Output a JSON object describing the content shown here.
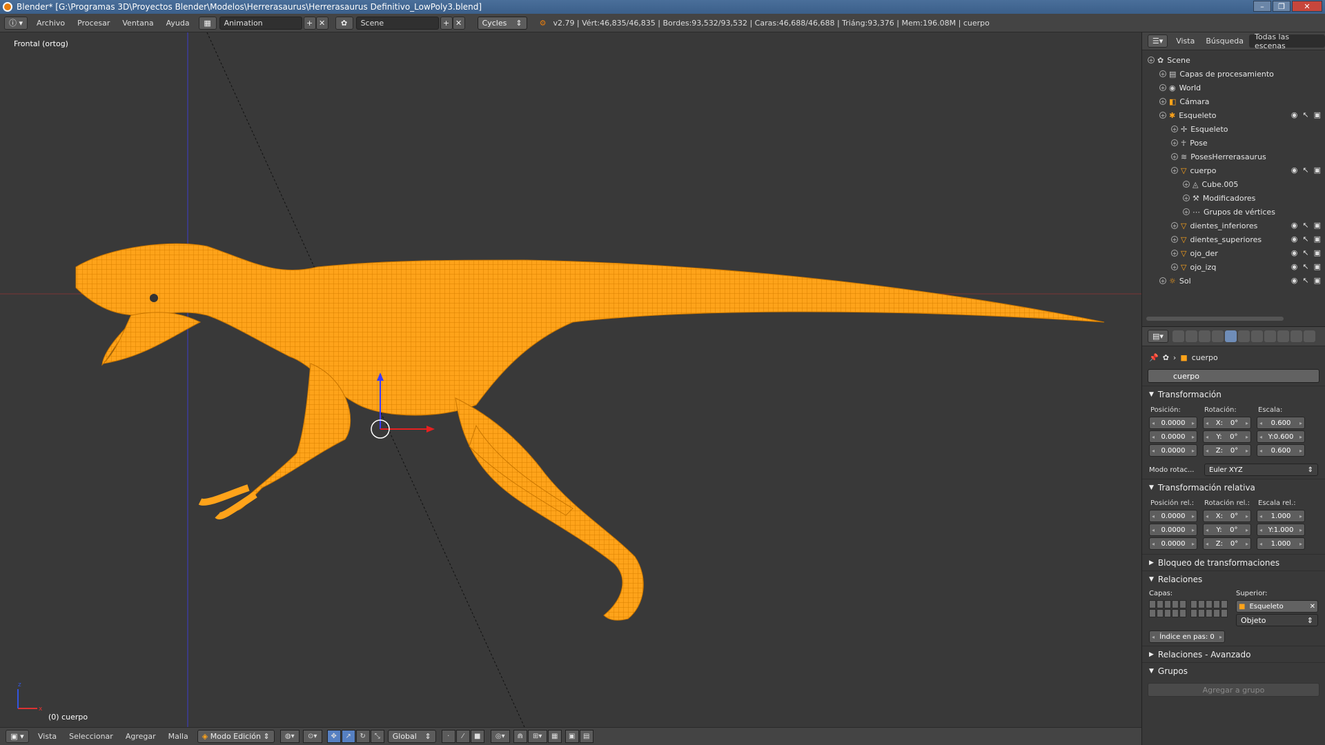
{
  "window": {
    "title": "Blender* [G:\\Programas 3D\\Proyectos Blender\\Modelos\\Herrerasaurus\\Herrerasaurus Definitivo_LowPoly3.blend]",
    "buttons": [
      "–",
      "❐",
      "✕"
    ]
  },
  "info_header": {
    "menus": [
      "Archivo",
      "Procesar",
      "Ventana",
      "Ayuda"
    ],
    "screen_layout": "Animation",
    "scene": "Scene",
    "render_engine": "Cycles",
    "stats": "v2.79 | Vért:46,835/46,835 | Bordes:93,532/93,532 | Caras:46,688/46,688 | Triáng:93,376 | Mem:196.08M | cuerpo"
  },
  "viewport": {
    "view_label": "Frontal (ortog)",
    "object_label": "(0) cuerpo",
    "mesh_color": "#ffa31a",
    "wire_color": "#e08600"
  },
  "bottom_header": {
    "menus": [
      "Vista",
      "Seleccionar",
      "Agregar",
      "Malla"
    ],
    "mode": "Modo Edición",
    "orientation": "Global"
  },
  "outliner": {
    "tabs": [
      "Vista",
      "Búsqueda",
      "Todas las escenas"
    ],
    "active_tab": "Todas las escenas",
    "items": [
      {
        "label": "Scene",
        "indent": 0,
        "icon": "scene-icon",
        "extra": ""
      },
      {
        "label": "Capas de procesamiento",
        "indent": 1,
        "icon": "render-layers-icon",
        "extra": ""
      },
      {
        "label": "World",
        "indent": 1,
        "icon": "world-icon",
        "extra": ""
      },
      {
        "label": "Cámara",
        "indent": 1,
        "icon": "camera-icon",
        "extra": "cam"
      },
      {
        "label": "Esqueleto",
        "indent": 1,
        "icon": "armature-icon",
        "extra": "obj"
      },
      {
        "label": "Esqueleto",
        "indent": 2,
        "icon": "armature-data-icon",
        "extra": "bones"
      },
      {
        "label": "Pose",
        "indent": 2,
        "icon": "pose-icon",
        "extra": ""
      },
      {
        "label": "PosesHerrerasaurus",
        "indent": 2,
        "icon": "action-icon",
        "extra": ""
      },
      {
        "label": "cuerpo",
        "indent": 2,
        "icon": "mesh-object-icon",
        "extra": "obj"
      },
      {
        "label": "Cube.005",
        "indent": 3,
        "icon": "mesh-data-icon",
        "extra": ""
      },
      {
        "label": "Modificadores",
        "indent": 3,
        "icon": "wrench-icon",
        "extra": ""
      },
      {
        "label": "Grupos de vértices",
        "indent": 3,
        "icon": "vertex-groups-icon",
        "extra": ""
      },
      {
        "label": "dientes_inferiores",
        "indent": 2,
        "icon": "mesh-object-icon",
        "extra": "obj"
      },
      {
        "label": "dientes_superiores",
        "indent": 2,
        "icon": "mesh-object-icon",
        "extra": "obj"
      },
      {
        "label": "ojo_der",
        "indent": 2,
        "icon": "mesh-object-icon",
        "extra": "obj"
      },
      {
        "label": "ojo_izq",
        "indent": 2,
        "icon": "mesh-object-icon",
        "extra": "obj"
      },
      {
        "label": "Sol",
        "indent": 1,
        "icon": "lamp-icon",
        "extra": "obj"
      }
    ]
  },
  "properties": {
    "breadcrumb": "cuerpo",
    "object_name": "cuerpo",
    "transform": {
      "title": "Transformación",
      "pos_label": "Posición:",
      "rot_label": "Rotación:",
      "scale_label": "Escala:",
      "position": [
        "0.0000",
        "0.0000",
        "0.0000"
      ],
      "rotation": [
        {
          "axis": "X:",
          "val": "0°"
        },
        {
          "axis": "Y:",
          "val": "0°"
        },
        {
          "axis": "Z:",
          "val": "0°"
        }
      ],
      "scale": [
        "0.600",
        "Y:0.600",
        "0.600"
      ],
      "rot_mode_label": "Modo rotac...",
      "rot_mode": "Euler XYZ"
    },
    "delta": {
      "title": "Transformación relativa",
      "pos_label": "Posición rel.:",
      "rot_label": "Rotación rel.:",
      "scale_label": "Escala rel.:",
      "position": [
        "0.0000",
        "0.0000",
        "0.0000"
      ],
      "rotation": [
        {
          "axis": "X:",
          "val": "0°"
        },
        {
          "axis": "Y:",
          "val": "0°"
        },
        {
          "axis": "Z:",
          "val": "0°"
        }
      ],
      "scale": [
        "1.000",
        "Y:1.000",
        "1.000"
      ]
    },
    "lock_title": "Bloqueo de transformaciones",
    "relations": {
      "title": "Relaciones",
      "layers_label": "Capas:",
      "parent_label": "Superior:",
      "parent": "Esqueleto",
      "parent_type": "Objeto",
      "pass_index": "Índice en pas:  0"
    },
    "relations_adv_title": "Relaciones - Avanzado",
    "groups_title": "Grupos",
    "add_group": "Agregar a grupo"
  }
}
